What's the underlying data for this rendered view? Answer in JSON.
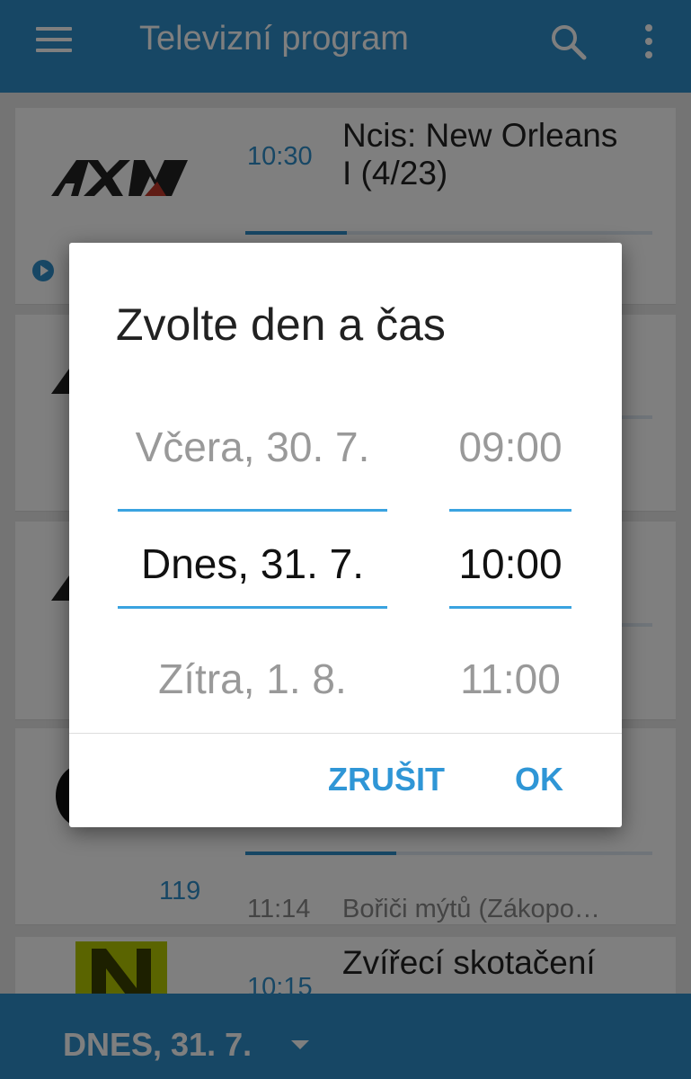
{
  "appbar": {
    "title": "Televizní program"
  },
  "cards": [
    {
      "channel_logo": "AXN",
      "time": "10:30",
      "program": [
        "Ncis: New Orleans",
        "I (4/23)"
      ],
      "progress": 0.25
    },
    {
      "channel_logo": "AXN"
    },
    {
      "channel_logo": "AXN"
    },
    {
      "channel_logo": "channel-logo",
      "number": "119",
      "next_time": "11:14",
      "next_program": "Bořiči mýtů (Zákopo…",
      "progress": 0.37
    },
    {
      "channel_logo": "N",
      "time": "10:15",
      "program": [
        "Zvířecí skotačení"
      ]
    }
  ],
  "bottombar": {
    "date_label": "DNES, 31. 7."
  },
  "dialog": {
    "title": "Zvolte den a čas",
    "day_picker": {
      "prev": "Včera, 30. 7.",
      "selected": "Dnes, 31. 7.",
      "next": "Zítra, 1. 8."
    },
    "time_picker": {
      "prev": "09:00",
      "selected": "10:00",
      "next": "11:00"
    },
    "cancel_label": "ZRUŠIT",
    "ok_label": "OK"
  },
  "colors": {
    "primary": "#2f8fca",
    "accent": "#3aa3e0",
    "button_text": "#2f96d6"
  }
}
